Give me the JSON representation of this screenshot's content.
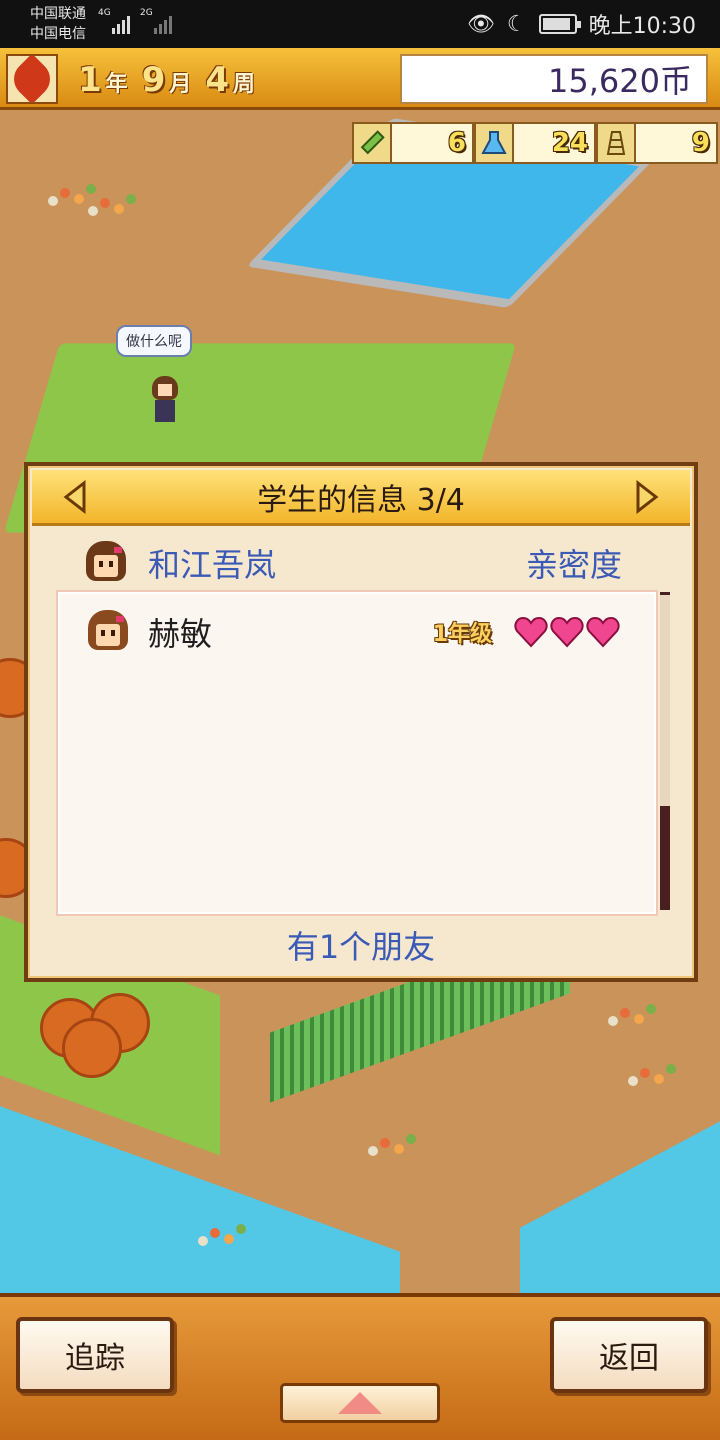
{
  "status_bar": {
    "carrier1": "中国联通",
    "carrier2": "中国电信",
    "net1": "4G",
    "net2": "2G",
    "time": "晚上10:30"
  },
  "hud": {
    "season_icon": "maple-leaf-icon",
    "year": "1",
    "year_unit": "年",
    "month": "9",
    "month_unit": "月",
    "week": "4",
    "week_unit": "周",
    "money": "15,620币"
  },
  "resources": [
    {
      "icon": "pencil-icon",
      "value": "6"
    },
    {
      "icon": "flask-icon",
      "value": "24"
    },
    {
      "icon": "trophy-icon",
      "value": "9"
    }
  ],
  "map": {
    "speech_bubble": "做什么呢"
  },
  "dialog": {
    "title": "学生的信息 3/4",
    "student_name": "和江吾岚",
    "affinity_label": "亲密度",
    "friends": [
      {
        "name": "赫敏",
        "grade": "1年级",
        "hearts": 3
      }
    ],
    "friend_count": "有1个朋友"
  },
  "bottom": {
    "track_label": "追踪",
    "back_label": "返回"
  },
  "colors": {
    "accent_blue": "#3a5ab5",
    "header_gold": "#f2b52a",
    "heart_pink": "#f0468f"
  }
}
